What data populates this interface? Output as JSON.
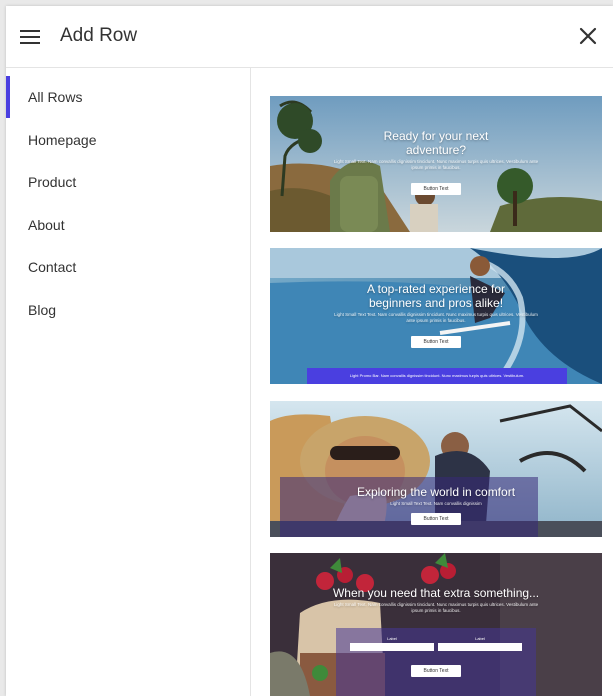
{
  "header": {
    "title": "Add Row",
    "menu_icon": "hamburger-menu-icon",
    "close_icon": "close-icon"
  },
  "sidebar": {
    "accent_color": "#4a3fe0",
    "items": [
      {
        "label": "All Rows",
        "active": true
      },
      {
        "label": "Homepage",
        "active": false
      },
      {
        "label": "Product",
        "active": false
      },
      {
        "label": "About",
        "active": false
      },
      {
        "label": "Contact",
        "active": false
      },
      {
        "label": "Blog",
        "active": false
      }
    ]
  },
  "rows": [
    {
      "headline_1": "Ready for your next",
      "headline_2": "adventure?",
      "sub": "Light Small Text. Nam convallis dignissim tincidunt. Nunc maximus turpis quis ultrices. Vestibulum ante ipsum primis in faucibus.",
      "button": "Button Text"
    },
    {
      "headline_1": "A top-rated experience for",
      "headline_2": "beginners and pros alike!",
      "sub": "Light Small Text Text. Nam convallis dignissim tincidunt. Nunc maximus turpis quis ultrices. Vestibulum ante ipsum primis in faucibus.",
      "button": "Button Text",
      "promo": "Light Promo Bar. Nam convallis dignissim tincidunt. Nunc maximus turpis quis ultrices. Vestibulum."
    },
    {
      "headline_1": "Exploring the world in comfort",
      "sub": "Light Small Text Text. Nam convallis dignissim",
      "button": "Button Text"
    },
    {
      "headline_1": "When you need that extra something...",
      "sub": "Light Small Text. Nam convallis dignissim tincidunt. Nunc maximus turpis quis ultrices. Vestibulum ante ipsum primis in faucibus.",
      "field_label_1": "Label",
      "field_label_2": "Label",
      "button": "Button Text"
    }
  ]
}
